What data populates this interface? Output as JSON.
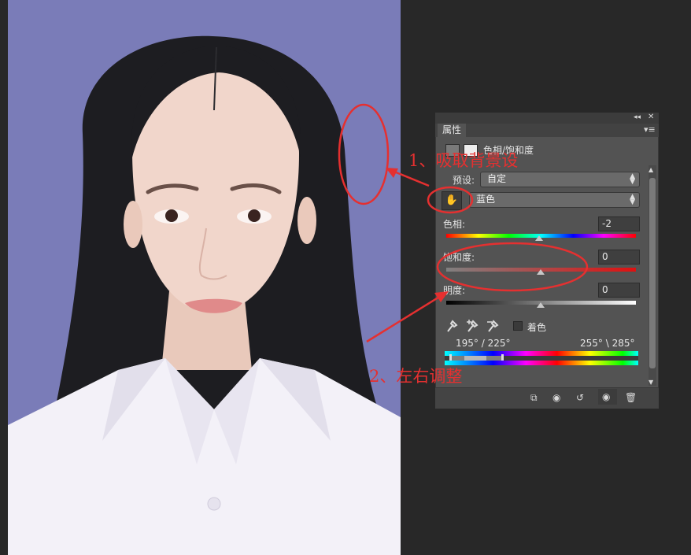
{
  "panel": {
    "title": "属性",
    "adjustment_name": "色相/饱和度",
    "preset_label": "预设:",
    "preset_value": "自定",
    "channel_value": "蓝色",
    "hue_label": "色相:",
    "hue_value": "-2",
    "saturation_label": "饱和度:",
    "saturation_value": "0",
    "lightness_label": "明度:",
    "lightness_value": "0",
    "colorize_label": "着色",
    "range_left": "195° / 225°",
    "range_right": "255° \\ 285°"
  },
  "annotations": {
    "step1": "1、吸取背景设",
    "step2": "2、左右调整"
  },
  "colors": {
    "photo_background": "#7a7cb8",
    "panel_background": "#535353",
    "annotation_red": "#e53030"
  }
}
